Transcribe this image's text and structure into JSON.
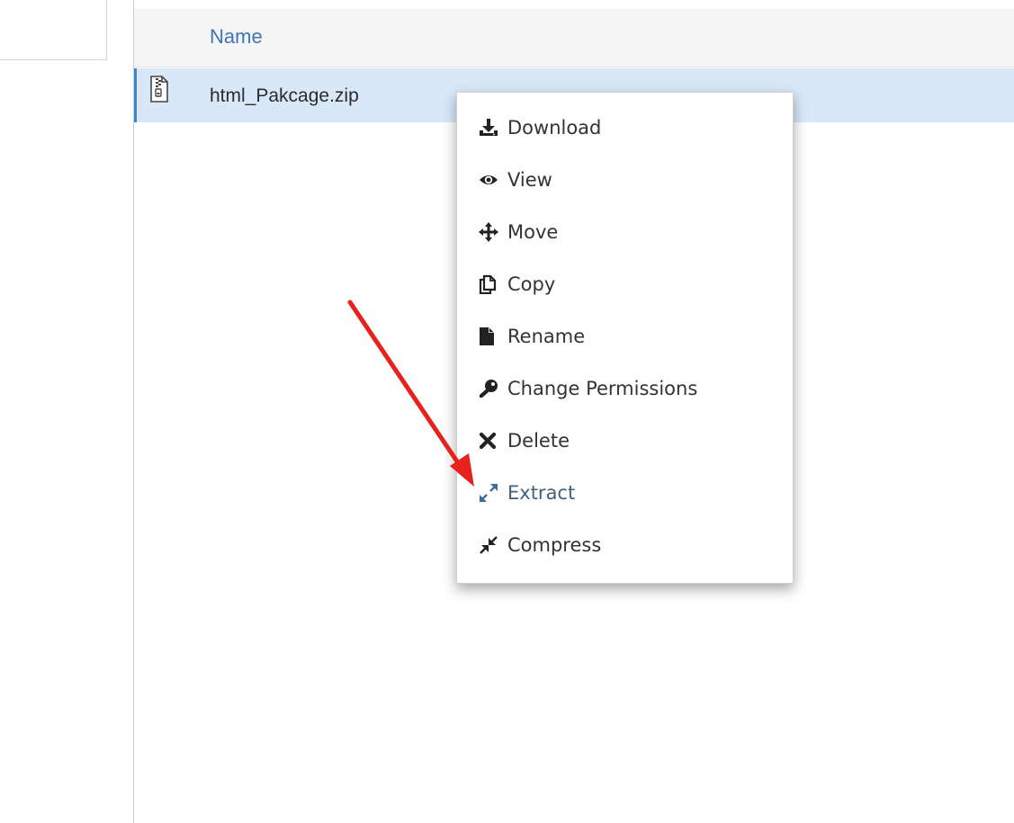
{
  "file_table": {
    "column_name": "Name",
    "files": [
      {
        "name": "html_Pakcage.zip",
        "icon": "zip-file-icon"
      }
    ]
  },
  "context_menu": {
    "items": [
      {
        "label": "Download",
        "icon": "download-icon"
      },
      {
        "label": "View",
        "icon": "eye-icon"
      },
      {
        "label": "Move",
        "icon": "move-arrows-icon"
      },
      {
        "label": "Copy",
        "icon": "copy-icon"
      },
      {
        "label": "Rename",
        "icon": "file-icon"
      },
      {
        "label": "Change Permissions",
        "icon": "key-icon"
      },
      {
        "label": "Delete",
        "icon": "close-icon"
      },
      {
        "label": "Extract",
        "icon": "expand-icon"
      },
      {
        "label": "Compress",
        "icon": "compress-icon"
      }
    ]
  },
  "colors": {
    "header_text": "#3d76b6",
    "selected_row": "#d8e8f8",
    "selected_row_border": "#3b87c8",
    "highlighted_item": "#41617f",
    "annotation_arrow": "#e8211d"
  }
}
